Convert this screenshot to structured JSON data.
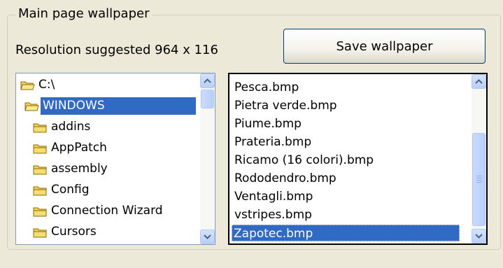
{
  "groupbox": {
    "title": "Main page wallpaper"
  },
  "resolution": {
    "label": "Resolution suggested 964 x 116"
  },
  "save_button": {
    "label": "Save wallpaper"
  },
  "directories": {
    "items": [
      {
        "label": "C:\\",
        "icon": "open-folder-icon",
        "selected": false
      },
      {
        "label": "WINDOWS",
        "icon": "open-folder-icon",
        "selected": true
      },
      {
        "label": "addins",
        "icon": "folder-icon",
        "selected": false
      },
      {
        "label": "AppPatch",
        "icon": "folder-icon",
        "selected": false
      },
      {
        "label": "assembly",
        "icon": "folder-icon",
        "selected": false
      },
      {
        "label": "Config",
        "icon": "folder-icon",
        "selected": false
      },
      {
        "label": "Connection Wizard",
        "icon": "folder-icon",
        "selected": false
      },
      {
        "label": "Cursors",
        "icon": "folder-icon",
        "selected": false
      }
    ]
  },
  "files": {
    "items": [
      {
        "label": "Pesca.bmp",
        "selected": false
      },
      {
        "label": "Pietra verde.bmp",
        "selected": false
      },
      {
        "label": "Piume.bmp",
        "selected": false
      },
      {
        "label": "Prateria.bmp",
        "selected": false
      },
      {
        "label": "Ricamo (16 colori).bmp",
        "selected": false
      },
      {
        "label": "Rododendro.bmp",
        "selected": false
      },
      {
        "label": "Ventagli.bmp",
        "selected": false
      },
      {
        "label": "vstripes.bmp",
        "selected": false
      },
      {
        "label": "Zapotec.bmp",
        "selected": true
      }
    ]
  },
  "colors": {
    "selection": "#316ac5",
    "folder": "#f5d250",
    "window_bg": "#ece9d8"
  }
}
